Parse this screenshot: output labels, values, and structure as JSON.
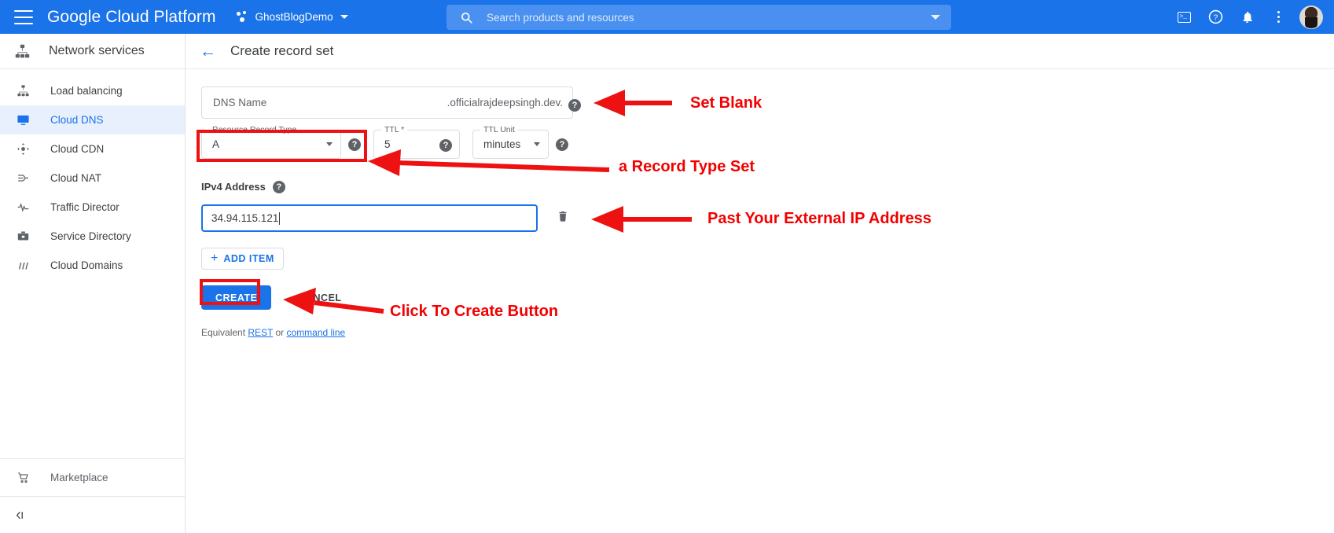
{
  "topbar": {
    "menu_icon": "hamburger-menu-icon",
    "brand": "Google Cloud Platform",
    "project_name": "GhostBlogDemo",
    "project_icon": "project-dots-icon",
    "search_placeholder": "Search products and resources",
    "search_icon": "search-icon",
    "icons": [
      "cloud-shell-icon",
      "help-icon",
      "notifications-bell-icon",
      "more-options-icon",
      "user-avatar"
    ],
    "background_color": "#1a73e8"
  },
  "sidebar": {
    "header": {
      "title": "Network services",
      "icon": "network-services-icon"
    },
    "items": [
      {
        "label": "Load balancing",
        "icon": "load-balancing-icon",
        "active": false
      },
      {
        "label": "Cloud DNS",
        "icon": "cloud-dns-icon",
        "active": true
      },
      {
        "label": "Cloud CDN",
        "icon": "cloud-cdn-icon",
        "active": false
      },
      {
        "label": "Cloud NAT",
        "icon": "cloud-nat-icon",
        "active": false
      },
      {
        "label": "Traffic Director",
        "icon": "traffic-director-icon",
        "active": false
      },
      {
        "label": "Service Directory",
        "icon": "service-directory-icon",
        "active": false
      },
      {
        "label": "Cloud Domains",
        "icon": "cloud-domains-icon",
        "active": false
      }
    ],
    "marketplace": {
      "label": "Marketplace",
      "icon": "marketplace-cart-icon"
    },
    "collapse": {
      "icon": "collapse-panel-icon"
    },
    "active_color": "#1a73e8",
    "active_background": "#e8f0fe"
  },
  "page": {
    "back_icon": "back-arrow-icon",
    "title": "Create record set"
  },
  "form": {
    "dns_name": {
      "placeholder": "DNS Name",
      "value": "",
      "suffix": ".officialrajdeepsingh.dev.",
      "help_icon": "help-circle-icon"
    },
    "resource_record_type": {
      "label": "Resource Record Type",
      "value": "A",
      "help_icon": "help-circle-icon",
      "dropdown_icon": "chevron-down-icon"
    },
    "ttl": {
      "label": "TTL *",
      "value": "5",
      "help_icon": "help-circle-icon"
    },
    "ttl_unit": {
      "label": "TTL Unit",
      "value": "minutes",
      "help_icon": "help-circle-icon",
      "dropdown_icon": "chevron-down-icon"
    },
    "ipv4": {
      "label": "IPv4 Address",
      "help_icon": "help-circle-icon",
      "value": "34.94.115.121",
      "delete_icon": "trash-icon"
    },
    "add_item": {
      "label": "ADD ITEM",
      "icon": "plus-icon"
    },
    "create_button": "CREATE",
    "cancel_button": "CANCEL",
    "equivalent": {
      "prefix": "Equivalent ",
      "rest_link": "REST",
      "middle": " or ",
      "cmd_link": "command line"
    }
  },
  "annotations": {
    "color": "#f20000",
    "items": [
      {
        "text": "Set Blank"
      },
      {
        "text": "a Record Type Set"
      },
      {
        "text": "Past Your External IP Address"
      },
      {
        "text": "Click To Create Button"
      }
    ]
  }
}
